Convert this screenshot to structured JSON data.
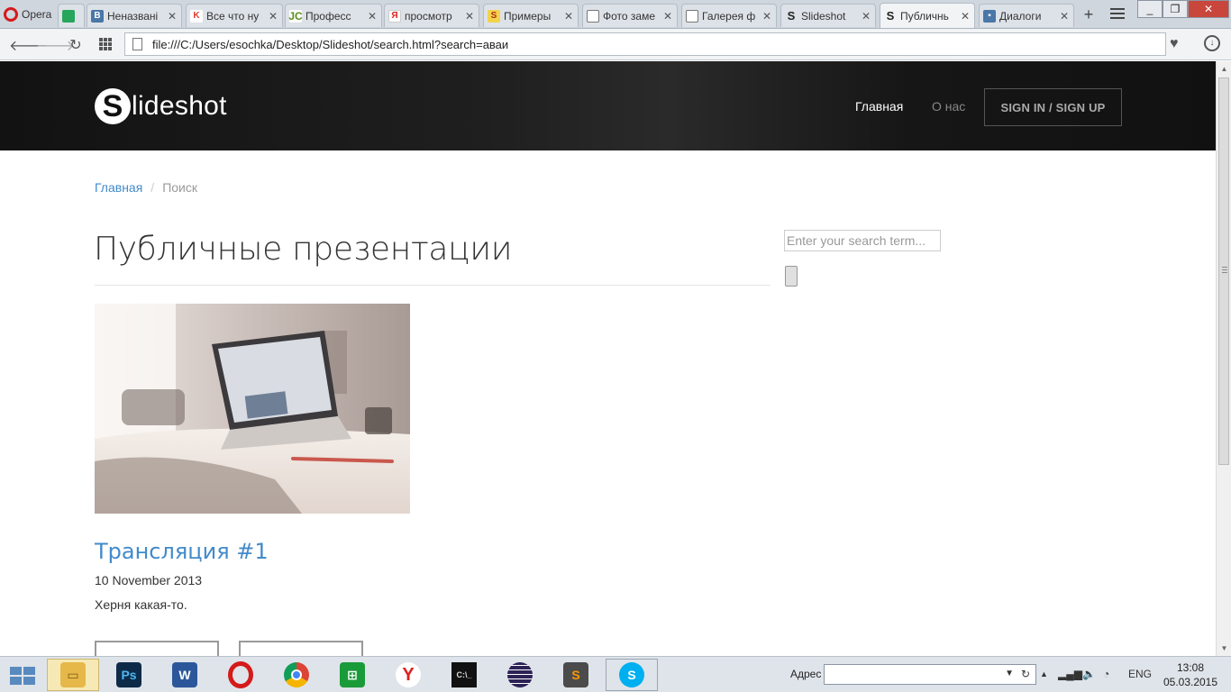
{
  "browser": {
    "menu_label": "Opera",
    "tabs": [
      {
        "title": "",
        "favicon": "trello-icon",
        "color": "#26a65b"
      },
      {
        "title": "Неназвані",
        "favicon": "vk-icon",
        "color": "#4a76a8"
      },
      {
        "title": "Все что ну",
        "favicon": "kinopoisk-icon",
        "color": "#e23b2e"
      },
      {
        "title": "Професс",
        "favicon": "jc-icon",
        "color": "#5a8f1c"
      },
      {
        "title": "просмотр",
        "favicon": "yandex-icon",
        "color": "#e02020"
      },
      {
        "title": "Примеры",
        "favicon": "sai-icon",
        "color": "#d69b1f"
      },
      {
        "title": "Фото заме",
        "favicon": "document-icon",
        "color": "#888888"
      },
      {
        "title": "Галерея ф",
        "favicon": "document-icon",
        "color": "#888888"
      },
      {
        "title": "Slideshot",
        "favicon": "slideshot-icon",
        "color": "#222222"
      },
      {
        "title": "Публичнь",
        "favicon": "slideshot-icon",
        "color": "#222222"
      },
      {
        "title": "Диалоги",
        "favicon": "vk-messages-icon",
        "color": "#4a76a8"
      }
    ],
    "new_tab": "+",
    "url": "file:///C:/Users/esochka/Desktop/Slideshot/search.html?search=аваи"
  },
  "site": {
    "logo_letter": "S",
    "logo_text": "lideshot",
    "nav": {
      "home": "Главная",
      "about": "О нас",
      "sign": "SIGN IN / SIGN UP"
    },
    "breadcrumb": {
      "home": "Главная",
      "separator": "/",
      "current": "Поиск"
    },
    "page_title": "Публичные презентации",
    "search": {
      "placeholder": "Enter your search term..."
    },
    "post": {
      "title": "Трансляция #1",
      "date": "10 November 2013",
      "description": "Херня какая-то."
    }
  },
  "taskbar": {
    "apps": [
      "file-explorer-icon",
      "photoshop-icon",
      "word-icon",
      "opera-icon",
      "chrome-icon",
      "windows-store-icon",
      "yandex-browser-icon",
      "command-prompt-icon",
      "eclipse-icon",
      "sublime-text-icon",
      "skype-icon"
    ],
    "address_label": "Адрес",
    "language": "ENG",
    "time": "13:08",
    "date": "05.03.2015"
  }
}
